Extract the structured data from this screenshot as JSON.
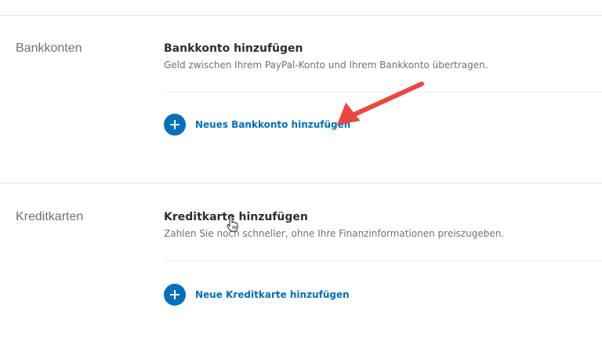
{
  "sections": [
    {
      "label": "Bankkonten",
      "title": "Bankkonto hinzufügen",
      "description": "Geld zwischen Ihrem PayPal-Konto und Ihrem Bankkonto übertragen.",
      "add_link": "Neues Bankkonto hinzufügen"
    },
    {
      "label": "Kreditkarten",
      "title": "Kreditkarte hinzufügen",
      "description": "Zahlen Sie noch schneller, ohne Ihre Finanzinformationen preiszugeben.",
      "add_link": "Neue Kreditkarte hinzufügen"
    }
  ],
  "icons": {
    "add": "plus-circle-icon",
    "annotation": "red-arrow",
    "cursor": "hand-pointer-cursor"
  },
  "colors": {
    "accent": "#0070ba",
    "annotation_arrow": "#e8483f",
    "label_gray": "#6c7378",
    "divider": "#dfe1e3"
  }
}
